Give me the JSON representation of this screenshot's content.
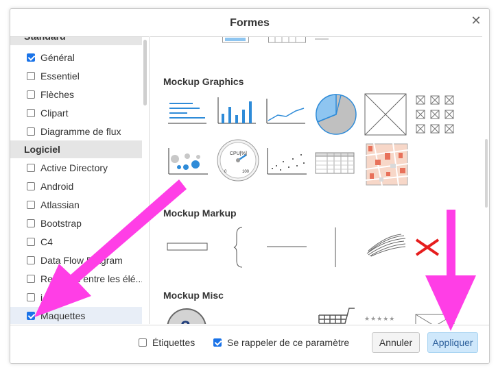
{
  "dialog": {
    "title": "Formes",
    "close_label": "✕"
  },
  "sidebar": {
    "header_standard": "Standard",
    "standard_items": [
      {
        "label": "Général",
        "checked": true
      },
      {
        "label": "Essentiel",
        "checked": false
      },
      {
        "label": "Flèches",
        "checked": false
      },
      {
        "label": "Clipart",
        "checked": false
      },
      {
        "label": "Diagramme de flux",
        "checked": false
      }
    ],
    "header_logiciel": "Logiciel",
    "logiciel_items": [
      {
        "label": "Active Directory",
        "checked": false
      },
      {
        "label": "Android",
        "checked": false
      },
      {
        "label": "Atlassian",
        "checked": false
      },
      {
        "label": "Bootstrap",
        "checked": false
      },
      {
        "label": "C4",
        "checked": false
      },
      {
        "label": "Data Flow Diagram",
        "checked": false
      },
      {
        "label": "Relations entre les élé...",
        "checked": false
      },
      {
        "label": "i",
        "checked": false
      },
      {
        "label": "Maquettes",
        "checked": true
      }
    ]
  },
  "main": {
    "sections": {
      "graphics": "Mockup Graphics",
      "markup": "Mockup Markup",
      "misc": "Mockup Misc"
    },
    "gauge_label": "CPU[%]",
    "gauge_min": "0",
    "gauge_max": "100",
    "help_glyph": "?",
    "stars": "★★★★★"
  },
  "footer": {
    "labels_text": "Étiquettes",
    "labels_checked": false,
    "remember_text": "Se rappeler de ce paramètre",
    "remember_checked": true,
    "cancel_label": "Annuler",
    "apply_label": "Appliquer"
  },
  "colors": {
    "accent": "#1a73e8",
    "chart_blue": "#2e8bd8",
    "annotation_magenta": "#ff3ee6",
    "error_red": "#e61e1e"
  }
}
